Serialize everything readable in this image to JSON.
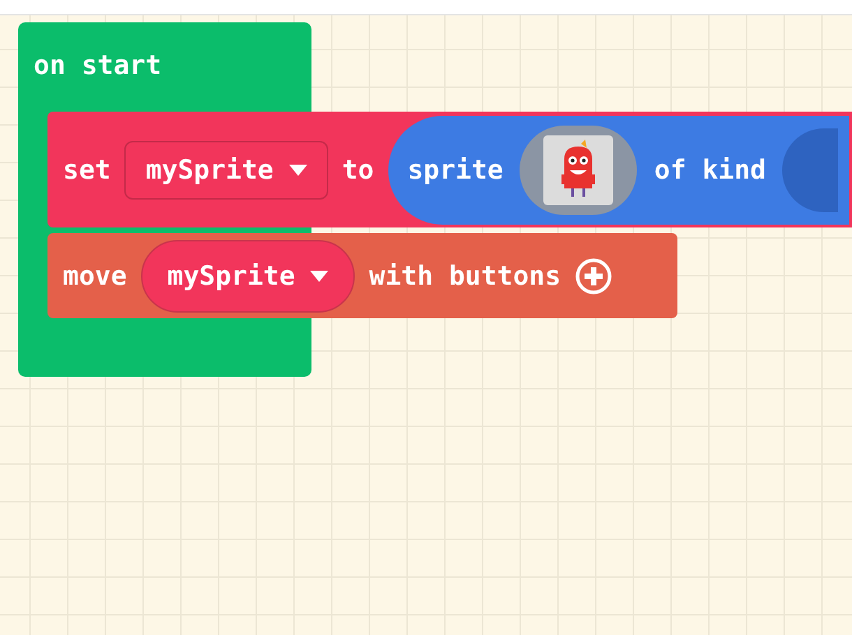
{
  "on_start": {
    "label": "on start"
  },
  "set_block": {
    "keyword": "set",
    "variable": "mySprite",
    "connector": "to",
    "value_block": {
      "label": "sprite",
      "connector": "of kind"
    }
  },
  "move_block": {
    "keyword": "move",
    "variable": "mySprite",
    "suffix": "with buttons"
  }
}
